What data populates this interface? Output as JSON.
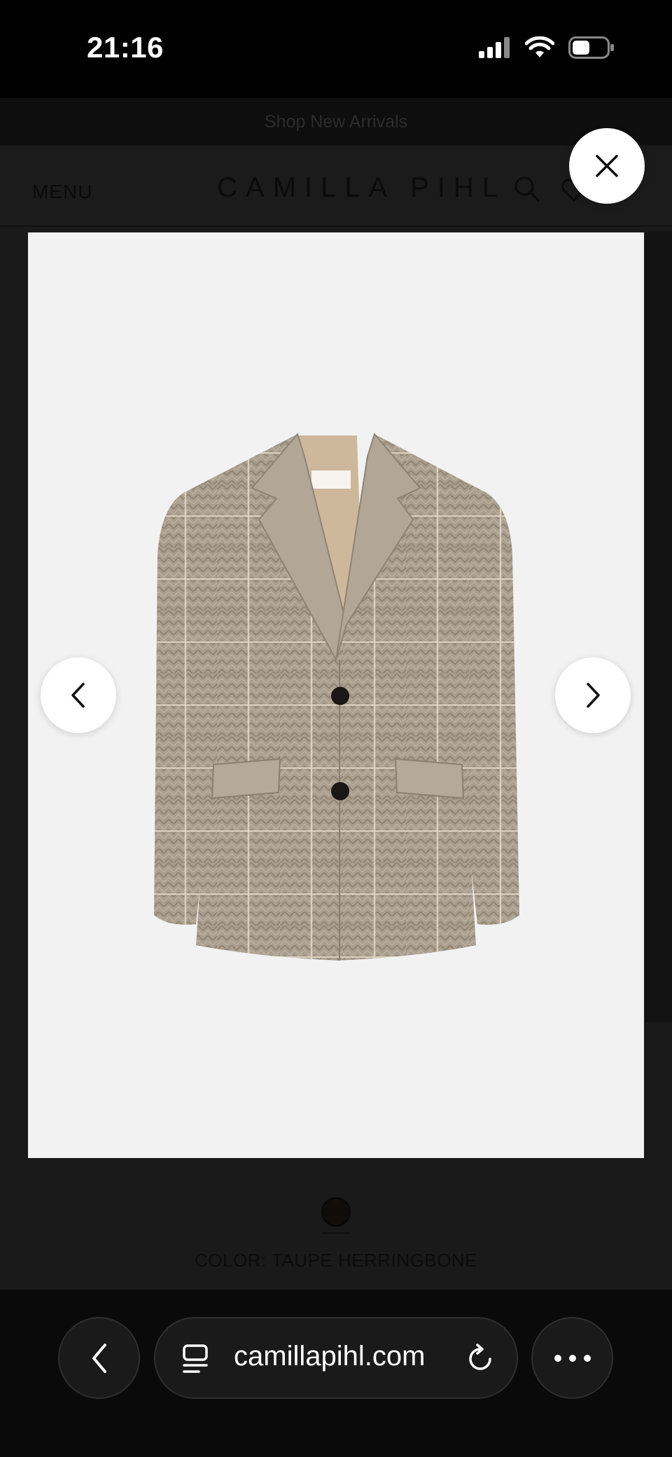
{
  "status_bar": {
    "time": "21:16"
  },
  "site": {
    "announcement": "Shop New Arrivals",
    "menu_label": "MENU",
    "logo": "CAMILLA PIHL",
    "color_label": "COLOR: TAUPE HERRINGBONE",
    "swatch_color": "#0f0c09"
  },
  "lightbox": {
    "image_alt": "Taupe herringbone checked wool blazer",
    "close_icon": "close-icon",
    "prev_icon": "chevron-left-icon",
    "next_icon": "chevron-right-icon"
  },
  "browser": {
    "url": "camillapihl.com",
    "back_icon": "chevron-left-icon",
    "tabs_icon": "page-menu-icon",
    "reload_icon": "reload-icon",
    "more_icon": "more-icon"
  },
  "colors": {
    "accent": "#ffffff",
    "background": "#000000",
    "image_bg": "#f2f2f2",
    "jacket": "#a89c8c"
  }
}
